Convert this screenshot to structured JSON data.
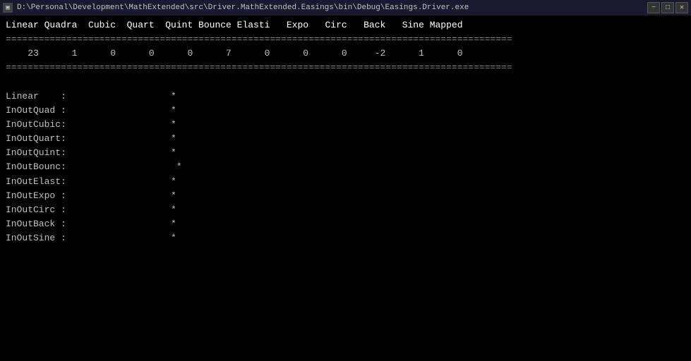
{
  "titleBar": {
    "icon": "▣",
    "path": "D:\\Personal\\Development\\MathExtended\\src\\Driver.MathExtended.Easings\\bin\\Debug\\Easings.Driver.exe",
    "minimizeLabel": "−",
    "maximizeLabel": "□",
    "closeLabel": "✕"
  },
  "console": {
    "header": "Linear Quadra  Cubic  Quart  Quint Bounce Elasti   Expo   Circ   Back   Sine Mapped",
    "separator1": "============================================================================================",
    "dataRow": "    23      1      0      0      0      7      0      0      0     -2      1      0",
    "separator2": "============================================================================================",
    "blank1": "",
    "rows": [
      {
        "label": "Linear    :",
        "value": "                   *"
      },
      {
        "label": "InOutQuad :",
        "value": "                   *"
      },
      {
        "label": "InOutCubic:",
        "value": "                   *"
      },
      {
        "label": "InOutQuart:",
        "value": "                   *"
      },
      {
        "label": "InOutQuint:",
        "value": "                   *"
      },
      {
        "label": "InOutBounc:",
        "value": "                    *"
      },
      {
        "label": "InOutElast:",
        "value": "                   *"
      },
      {
        "label": "InOutExpo :",
        "value": "                   *"
      },
      {
        "label": "InOutCirc :",
        "value": "                   *"
      },
      {
        "label": "InOutBack :",
        "value": "                   *"
      },
      {
        "label": "InOutSine :",
        "value": "                   *"
      }
    ]
  }
}
